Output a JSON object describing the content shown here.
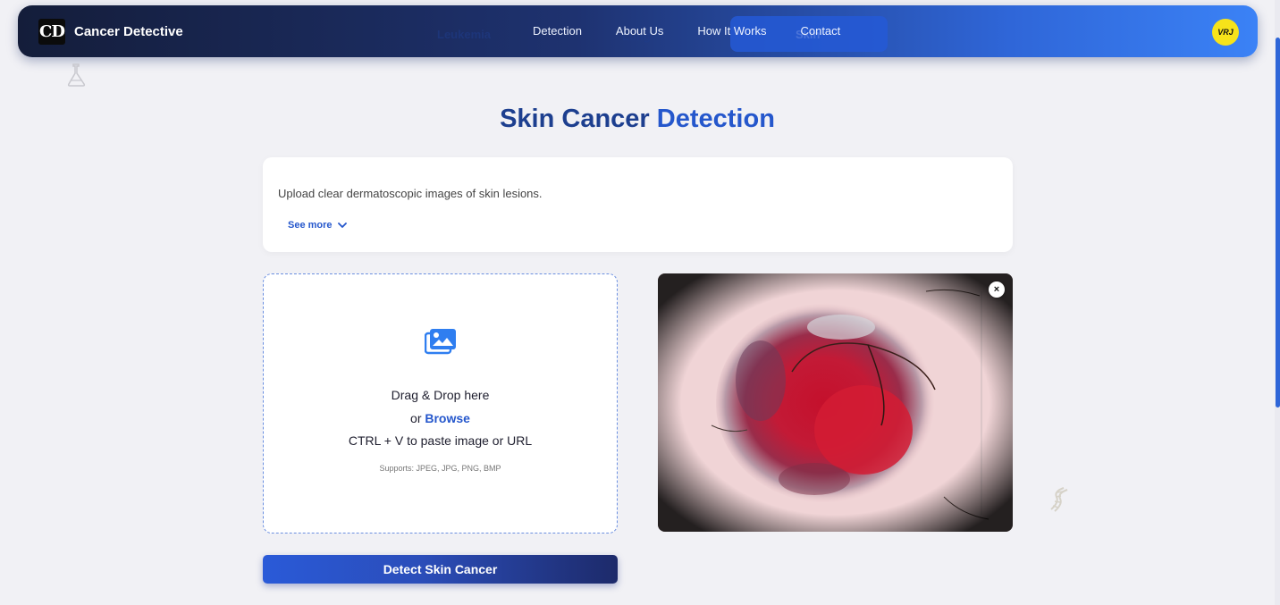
{
  "navbar": {
    "brand_logo": "CD",
    "brand_name": "Cancer Detective",
    "ghost_items": [
      "Leukemia",
      "Lung",
      "Skin"
    ],
    "links": [
      "Detection",
      "About Us",
      "How It Works",
      "Contact"
    ],
    "avatar_text": "VRJ",
    "gradient_colors": [
      "#141d3a",
      "#1e3270",
      "#2f66d8",
      "#3b82f6"
    ]
  },
  "page": {
    "title_part1": "Skin Cancer",
    "title_part2": "Detection"
  },
  "info": {
    "text": "Upload clear dermatoscopic images of skin lesions.",
    "see_more": "See more"
  },
  "dropzone": {
    "line1": "Drag & Drop here",
    "line2_prefix": "or",
    "browse": "Browse",
    "line3": "CTRL + V to paste image or URL",
    "supports": "Supports: JPEG, JPG, PNG, BMP",
    "icon": "images-icon"
  },
  "preview": {
    "close_label": "×"
  },
  "actions": {
    "detect_label": "Detect Skin Cancer"
  },
  "colors": {
    "accent": "#2557cc",
    "title_dark": "#1d3f8f",
    "background": "#f1f1f5"
  }
}
